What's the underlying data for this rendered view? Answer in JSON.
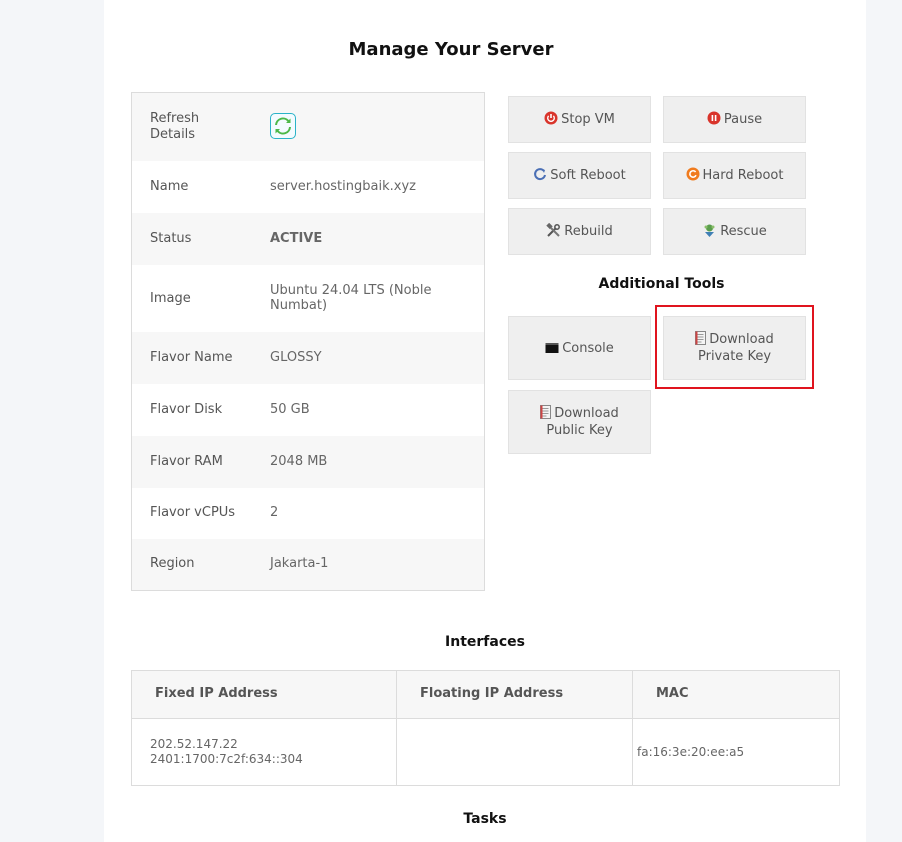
{
  "page": {
    "title": "Manage Your Server"
  },
  "details": {
    "refresh_label": "Refresh\nDetails",
    "rows": [
      {
        "label": "Name",
        "value": "server.hostingbaik.xyz"
      },
      {
        "label": "Status",
        "value": "ACTIVE"
      },
      {
        "label": "Image",
        "value": "Ubuntu 24.04 LTS (Noble Numbat)"
      },
      {
        "label": "Flavor Name",
        "value": "GLOSSY"
      },
      {
        "label": "Flavor Disk",
        "value": "50 GB"
      },
      {
        "label": "Flavor RAM",
        "value": "2048 MB"
      },
      {
        "label": "Flavor vCPUs",
        "value": "2"
      },
      {
        "label": "Region",
        "value": "Jakarta-1"
      }
    ]
  },
  "actions": {
    "stop_vm": "Stop VM",
    "pause": "Pause",
    "soft_reboot": "Soft Reboot",
    "hard_reboot": "Hard Reboot",
    "rebuild": "Rebuild",
    "rescue": "Rescue"
  },
  "tools": {
    "title": "Additional Tools",
    "console": "Console",
    "download_private_key": "Download Private Key",
    "download_public_key": "Download Public Key"
  },
  "interfaces": {
    "title": "Interfaces",
    "headers": [
      "Fixed IP Address",
      "Floating IP Address",
      "MAC"
    ],
    "row": {
      "fixed_ip_v4": "202.52.147.22",
      "fixed_ip_v6": "2401:1700:7c2f:634::304",
      "floating_ip": "",
      "mac": "fa:16:3e:20:ee:a5"
    }
  },
  "tasks": {
    "title": "Tasks"
  },
  "colors": {
    "active": "#0a8a0a",
    "highlight": "#e0141e",
    "button_bg": "#efefef"
  }
}
